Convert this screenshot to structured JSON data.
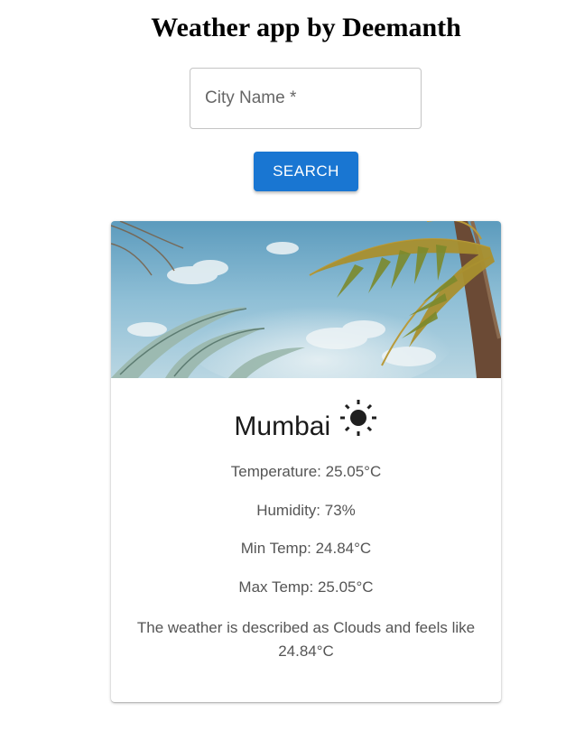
{
  "header": {
    "title": "Weather app by Deemanth"
  },
  "search": {
    "placeholder": "City Name *",
    "value": "",
    "button_label": "SEARCH"
  },
  "card": {
    "image": "palm-trees-sky-photo",
    "city": "Mumbai",
    "weather_icon": "sun-icon",
    "temperature": "Temperature: 25.05°C",
    "humidity": "Humidity: 73%",
    "min_temp": "Min Temp: 24.84°C",
    "max_temp": "Max Temp: 25.05°C",
    "description": "The weather is described as Clouds and feels like 24.84°C"
  },
  "colors": {
    "accent": "#1976d2"
  }
}
